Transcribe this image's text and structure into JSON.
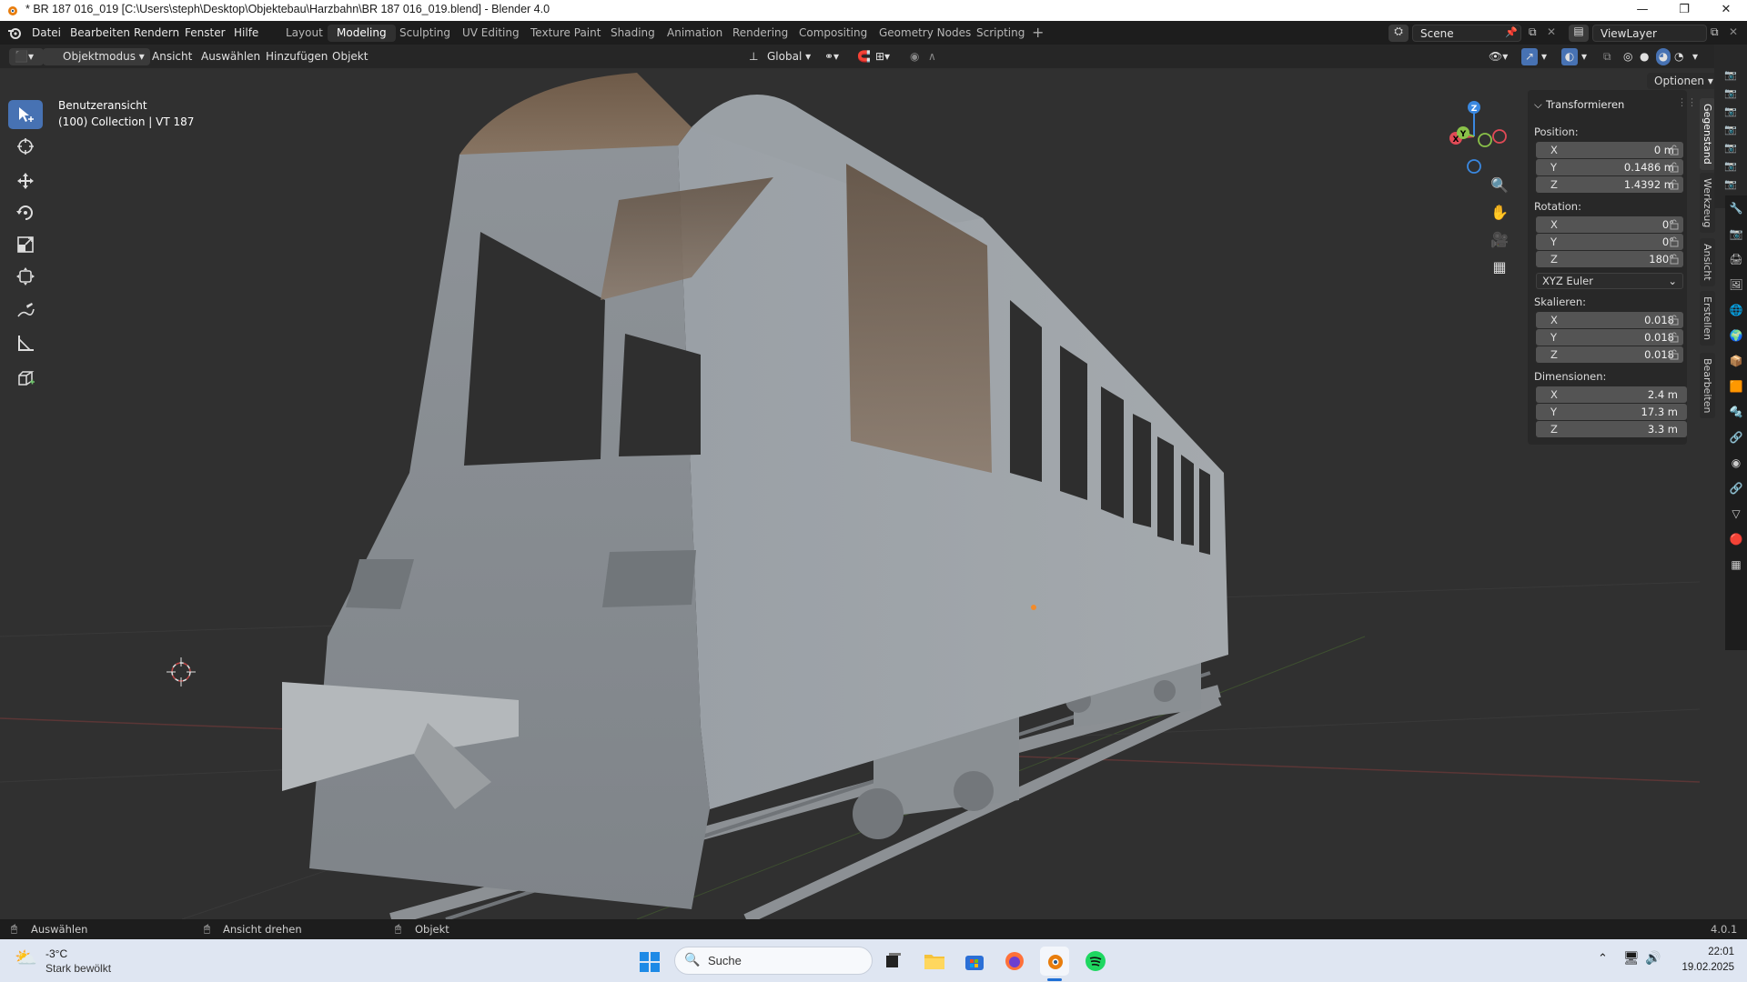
{
  "window": {
    "title": "* BR 187 016_019 [C:\\Users\\steph\\Desktop\\Objektebau\\Harzbahn\\BR 187 016_019.blend] - Blender 4.0"
  },
  "menus": [
    "Datei",
    "Bearbeiten",
    "Rendern",
    "Fenster",
    "Hilfe"
  ],
  "workspaces": [
    "Layout",
    "Modeling",
    "Sculpting",
    "UV Editing",
    "Texture Paint",
    "Shading",
    "Animation",
    "Rendering",
    "Compositing",
    "Geometry Nodes",
    "Scripting"
  ],
  "active_workspace": "Modeling",
  "scene": "Scene",
  "view_layer": "ViewLayer",
  "header": {
    "mode": "Objektmodus",
    "menus": [
      "Ansicht",
      "Auswählen",
      "Hinzufügen",
      "Objekt"
    ],
    "orientation": "Global",
    "options": "Optionen"
  },
  "viewport": {
    "view_name": "Benutzeransicht",
    "collection_info": "(100) Collection | VT 187"
  },
  "gizmo": {
    "x": "X",
    "y": "Y",
    "z": "Z"
  },
  "npanel": {
    "title": "Transformieren",
    "position_label": "Position:",
    "position": {
      "x": "0 m",
      "y": "0.1486 m",
      "z": "1.4392 m"
    },
    "rotation_label": "Rotation:",
    "rotation": {
      "x": "0°",
      "y": "0°",
      "z": "180°"
    },
    "rotation_mode": "XYZ Euler",
    "scale_label": "Skalieren:",
    "scale": {
      "x": "0.018",
      "y": "0.018",
      "z": "0.018"
    },
    "dimensions_label": "Dimensionen:",
    "dimensions": {
      "x": "2.4 m",
      "y": "17.3 m",
      "z": "3.3 m"
    },
    "axis": {
      "x": "X",
      "y": "Y",
      "z": "Z"
    }
  },
  "side_tabs": [
    "Gegenstand",
    "Werkzeug",
    "Ansicht",
    "Erstellen",
    "Bearbeiten"
  ],
  "statusbar": {
    "select": "Auswählen",
    "rotate": "Ansicht drehen",
    "object": "Objekt",
    "version": "4.0.1"
  },
  "taskbar": {
    "weather_temp": "-3°C",
    "weather_desc": "Stark bewölkt",
    "search": "Suche",
    "time": "22:01",
    "date": "19.02.2025"
  },
  "colors": {
    "accent": "#4772b3",
    "x_axis": "#e04a56",
    "y_axis": "#8ac249",
    "z_axis": "#3a88e0"
  }
}
